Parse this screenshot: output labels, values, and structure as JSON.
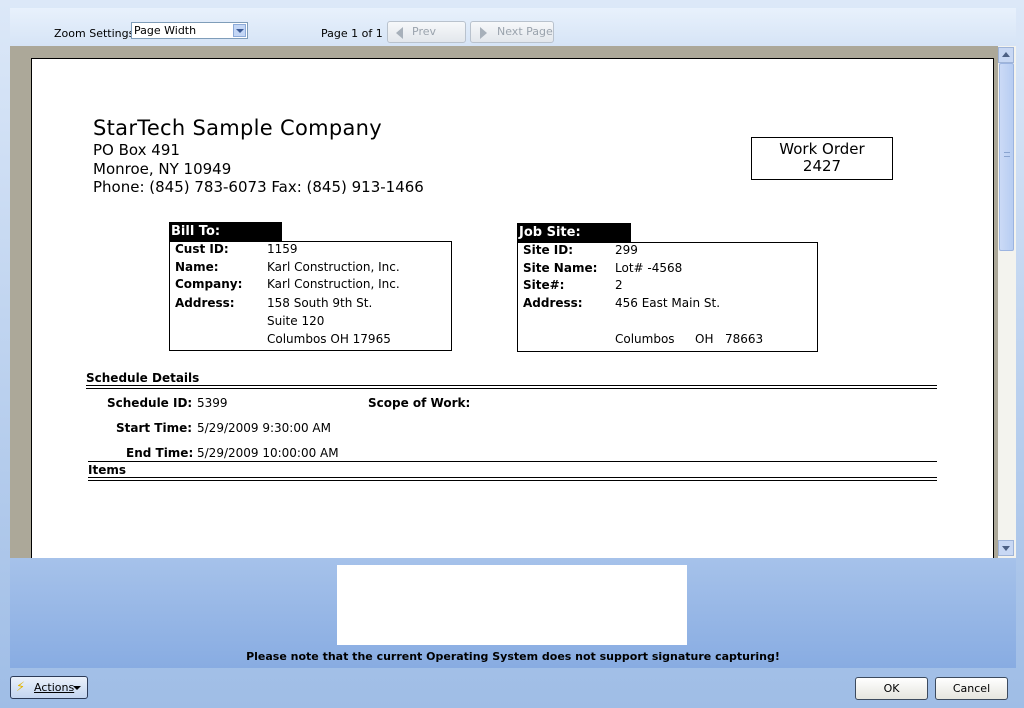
{
  "toolbar": {
    "zoom_label": "Zoom Settings",
    "zoom_value": "Page Width",
    "page_info": "Page 1 of 1",
    "prev_label": "Prev Page",
    "next_label": "Next Page"
  },
  "report": {
    "company_name": "StarTech Sample Company",
    "address_line1": "PO Box 491",
    "address_line2": "Monroe, NY 10949",
    "phone_fax": "Phone: (845) 783-6073  Fax: (845) 913-1466",
    "work_order_label": "Work Order",
    "work_order_number": "2427",
    "bill_to": {
      "header": "Bill To:",
      "cust_id_label": "Cust ID:",
      "cust_id": "1159",
      "name_label": "Name:",
      "name": "Karl Construction, Inc.",
      "company_label": "Company:",
      "company": "Karl Construction, Inc.",
      "address_label": "Address:",
      "address1": "158 South 9th St.",
      "address2": "Suite 120",
      "address3": "Columbos OH 17965"
    },
    "job_site": {
      "header": "Job Site:",
      "site_id_label": "Site ID:",
      "site_id": "299",
      "site_name_label": "Site Name:",
      "site_name": "Lot# -4568",
      "site_num_label": "Site#:",
      "site_num": "2",
      "address_label": "Address:",
      "address1": "456 East Main St.",
      "city": "Columbos",
      "state": "OH",
      "zip": "78663"
    },
    "schedule": {
      "header": "Schedule Details",
      "schedule_id_label": "Schedule ID:",
      "schedule_id": "5399",
      "scope_label": "Scope of Work:",
      "start_label": "Start Time:",
      "start_time": "5/29/2009 9:30:00 AM",
      "end_label": "End Time:",
      "end_time": "5/29/2009 10:00:00 AM"
    },
    "items_header": "Items"
  },
  "signature": {
    "note": "Please note that the current Operating System does not support signature capturing!"
  },
  "buttons": {
    "actions": "Actions",
    "ok": "OK",
    "cancel": "Cancel"
  }
}
